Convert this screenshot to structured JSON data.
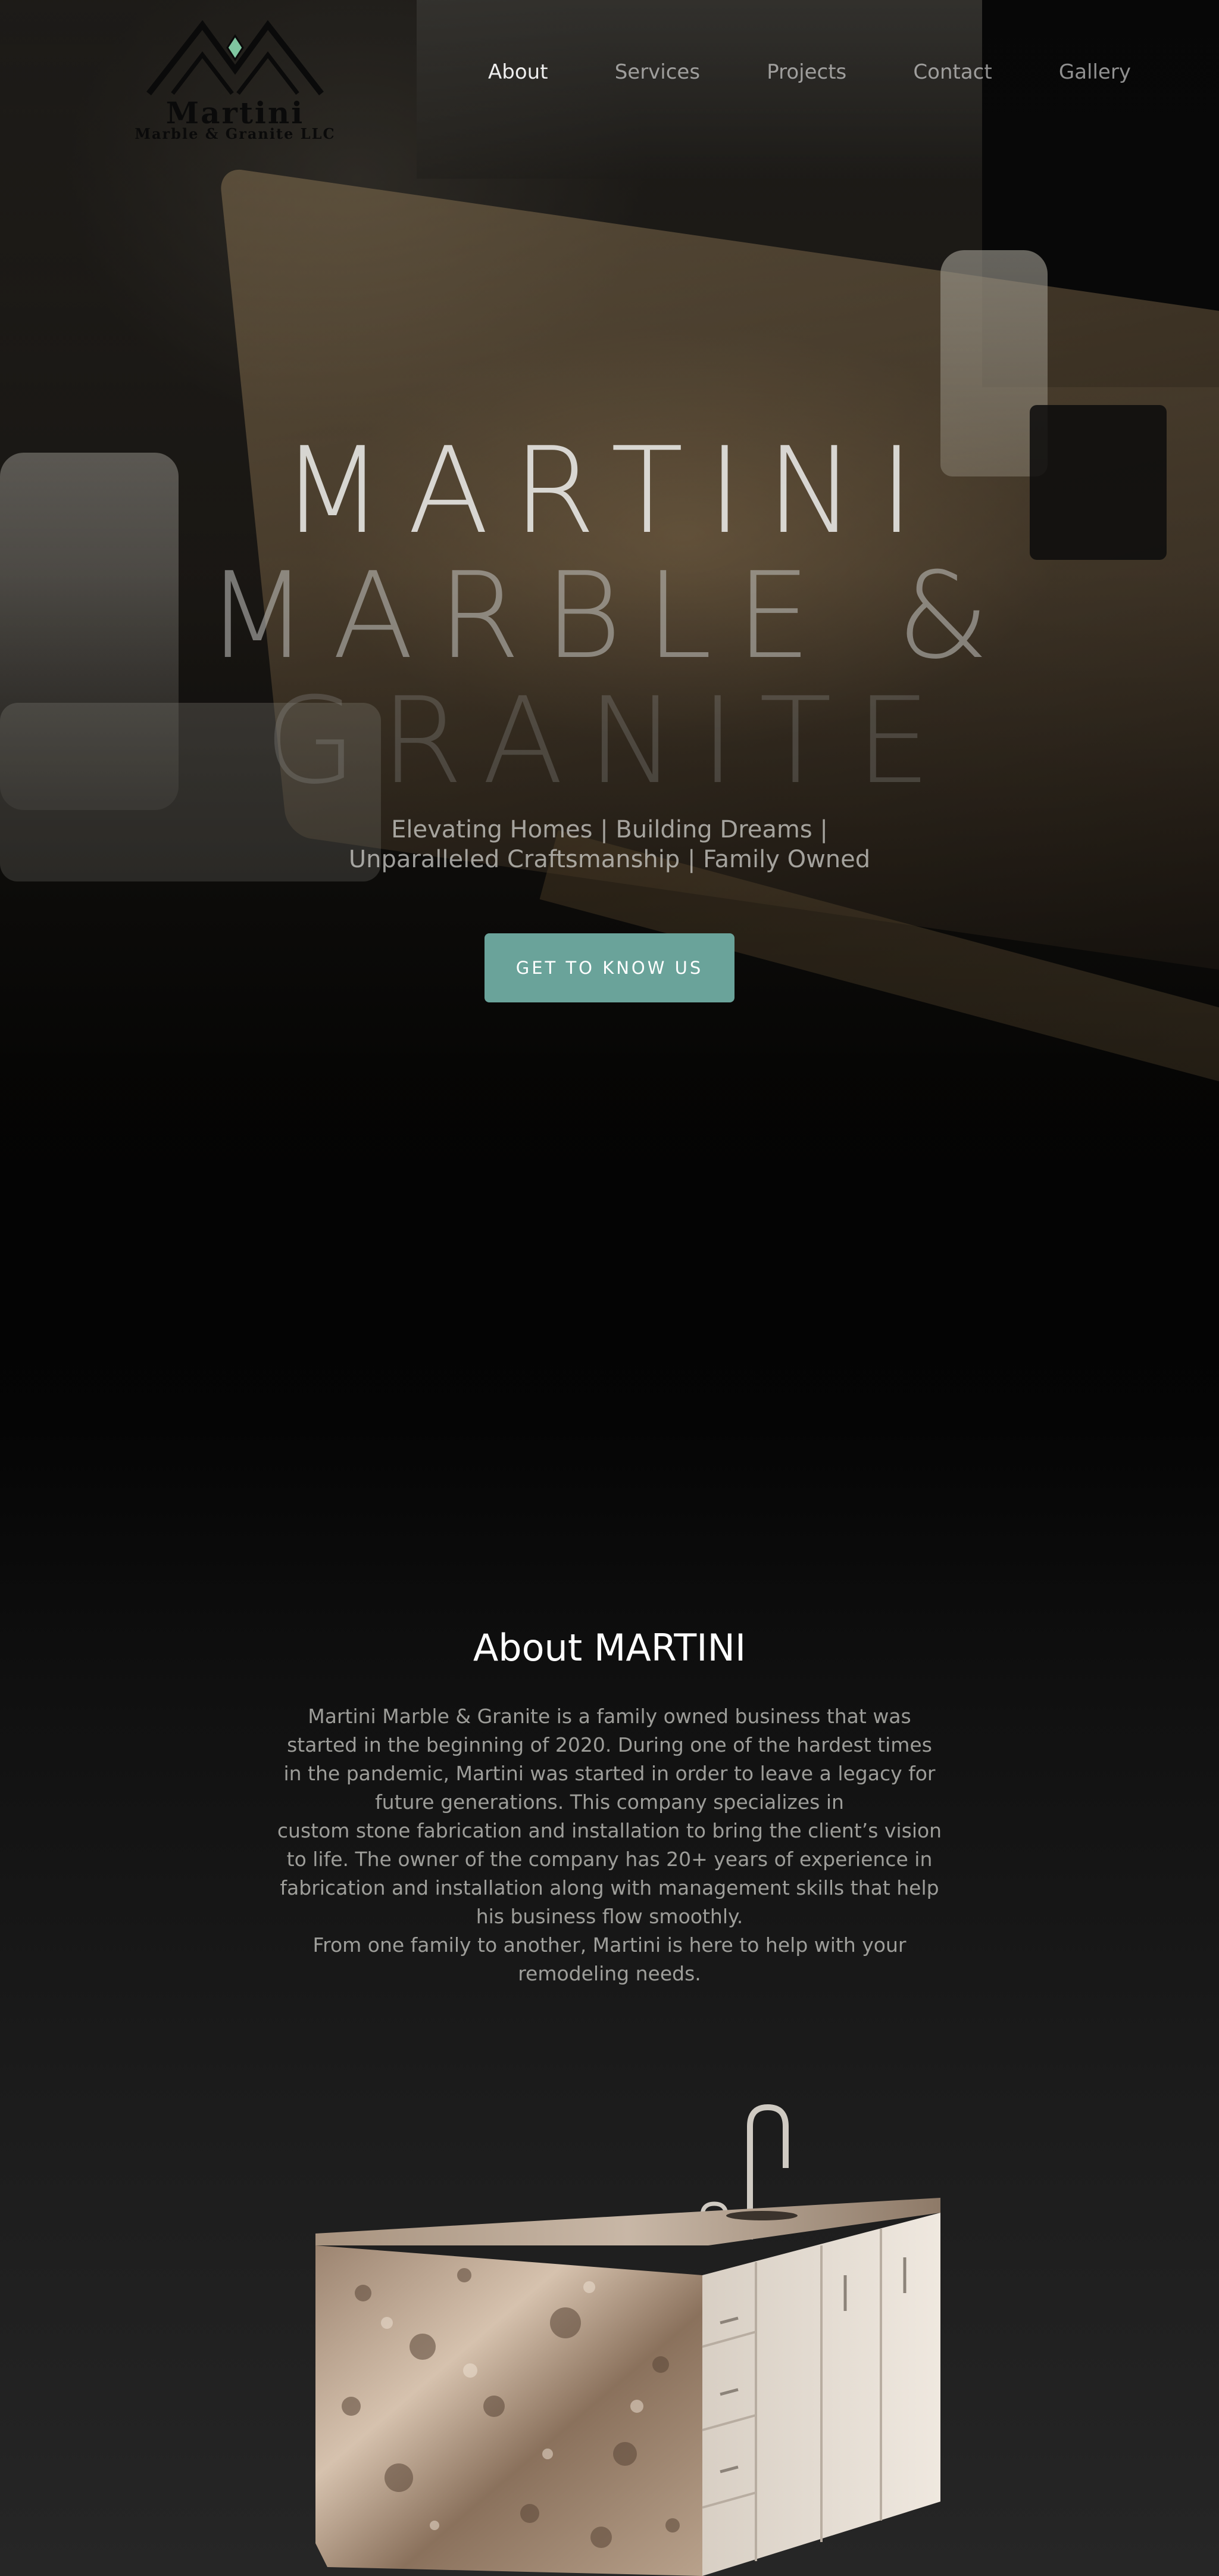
{
  "logo": {
    "name": "Martini",
    "subtitle": "Marble & Granite LLC"
  },
  "nav": {
    "items": [
      {
        "label": "About",
        "active": true
      },
      {
        "label": "Services",
        "active": false
      },
      {
        "label": "Projects",
        "active": false
      },
      {
        "label": "Contact",
        "active": false
      },
      {
        "label": "Gallery",
        "active": false
      }
    ]
  },
  "hero": {
    "title_line1": "MARTINI",
    "title_line2": "MARBLE &",
    "title_line3": "GRANITE",
    "subtitle_line1": "Elevating Homes | Building Dreams |",
    "subtitle_line2": "Unparalleled Craftsmanship | Family Owned",
    "cta_label": "GET TO KNOW US"
  },
  "about": {
    "title": "About MARTINI",
    "paragraph1": "Martini Marble & Granite is a family owned business that was started in the beginning of 2020. During one of the hardest times in the pandemic, Martini was started in order to leave a legacy for future generations. This company specializes in",
    "paragraph2": "custom stone fabrication and installation to bring the client’s vision to life. The owner of the company has 20+ years of experience in fabrication and installation along with management skills that help his business flow smoothly.",
    "paragraph3": "From one family to another, Martini is here to help with your remodeling needs."
  },
  "colors": {
    "accent": "#6aa39a",
    "background": "#050505",
    "logo_diamond": "#7fc6a0"
  }
}
